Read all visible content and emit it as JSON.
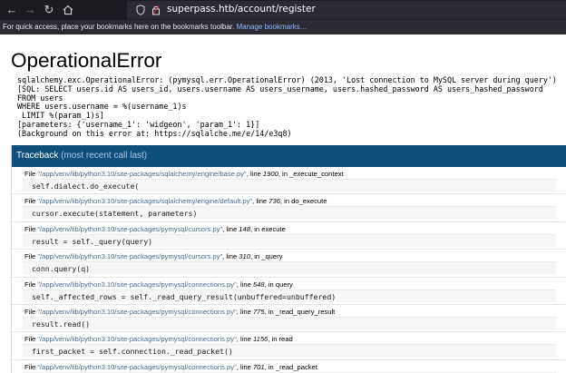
{
  "browser": {
    "url": "superpass.htb/account/register",
    "bookmarks_text": "For quick access, place your bookmarks here on the bookmarks toolbar.",
    "bookmarks_link": "Manage bookmarks…"
  },
  "error": {
    "title": "OperationalError",
    "lines": [
      "sqlalchemy.exc.OperationalError: (pymysql.err.OperationalError) (2013, 'Lost connection to MySQL server during query')",
      "[SQL: SELECT users.id AS users_id, users.username AS users_username, users.hashed_password AS users_hashed_password",
      "FROM users",
      "WHERE users.username = %(username_1)s",
      " LIMIT %(param_1)s]",
      "[parameters: {'username_1': 'widgeon', 'param_1': 1}]",
      "(Background on this error at: https://sqlalche.me/e/14/e3q8)"
    ]
  },
  "traceback": {
    "title": "Traceback",
    "subtitle": "(most recent call last)",
    "frames": [
      {
        "file": "\"/app/venv/lib/python3.10/site-packages/sqlalchemy/engine/base.py\"",
        "line": "1900",
        "func": "_execute_context",
        "code": "self.dialect.do_execute("
      },
      {
        "file": "\"/app/venv/lib/python3.10/site-packages/sqlalchemy/engine/default.py\"",
        "line": "736",
        "func": "do_execute",
        "code": "cursor.execute(statement, parameters)"
      },
      {
        "file": "\"/app/venv/lib/python3.10/site-packages/pymysql/cursors.py\"",
        "line": "148",
        "func": "execute",
        "code": "result = self._query(query)"
      },
      {
        "file": "\"/app/venv/lib/python3.10/site-packages/pymysql/cursors.py\"",
        "line": "310",
        "func": "_query",
        "code": "conn.query(q)"
      },
      {
        "file": "\"/app/venv/lib/python3.10/site-packages/pymysql/connections.py\"",
        "line": "548",
        "func": "query",
        "code": "self._affected_rows = self._read_query_result(unbuffered=unbuffered)"
      },
      {
        "file": "\"/app/venv/lib/python3.10/site-packages/pymysql/connections.py\"",
        "line": "775",
        "func": "_read_query_result",
        "code": "result.read()"
      },
      {
        "file": "\"/app/venv/lib/python3.10/site-packages/pymysql/connections.py\"",
        "line": "1156",
        "func": "read",
        "code": "first_packet = self.connection._read_packet()"
      },
      {
        "file": "\"/app/venv/lib/python3.10/site-packages/pymysql/connections.py\"",
        "line": "701",
        "func": "_read_packet",
        "code": ""
      }
    ]
  }
}
